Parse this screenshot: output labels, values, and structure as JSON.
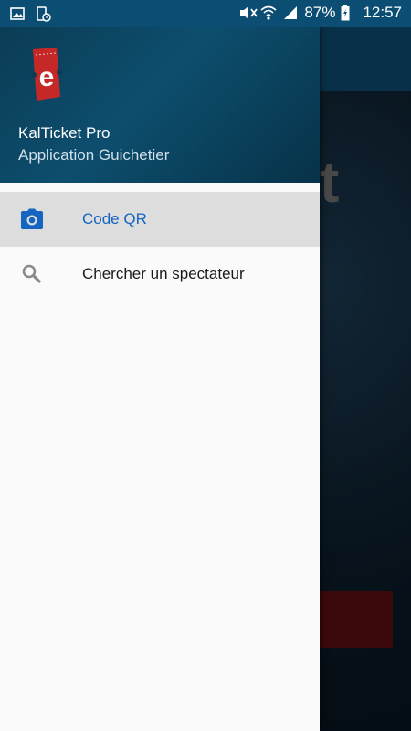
{
  "status_bar": {
    "battery": "87%",
    "time": "12:57"
  },
  "background": {
    "letter": "t"
  },
  "drawer": {
    "header": {
      "title": "KalTicket Pro",
      "subtitle": "Application Guichetier",
      "logo_letter": "e"
    },
    "items": [
      {
        "label": "Code QR",
        "icon": "camera-icon",
        "active": true
      },
      {
        "label": "Chercher un spectateur",
        "icon": "search-icon",
        "active": false
      }
    ]
  },
  "colors": {
    "accent": "#1565c0",
    "header": "#0d4e6e",
    "logo_red": "#c62828"
  }
}
